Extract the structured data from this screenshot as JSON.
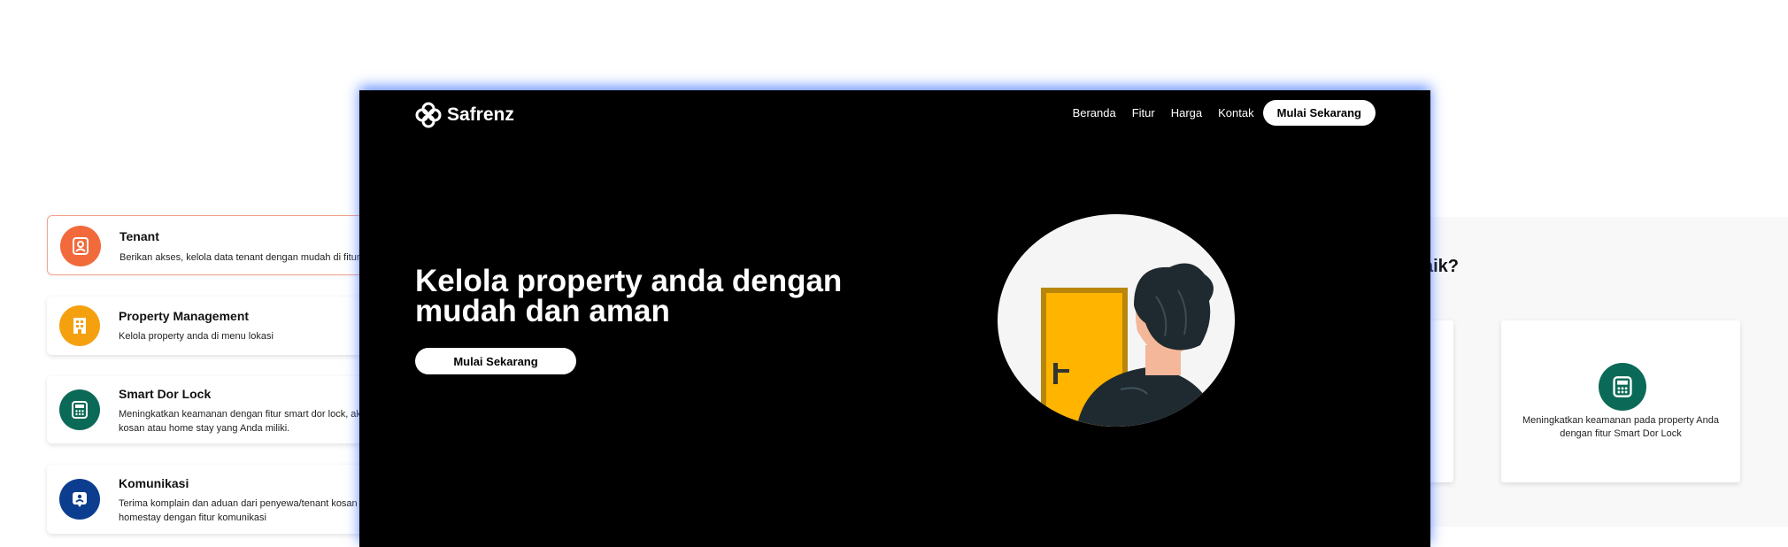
{
  "features": [
    {
      "title": "Tenant",
      "desc": "Berikan akses, kelola data tenant dengan mudah di fitur tenant",
      "icon": "tenant-user-icon",
      "color": "#f26a3b"
    },
    {
      "title": "Property Management",
      "desc": "Kelola property anda di menu lokasi",
      "icon": "building-icon",
      "color": "#f5a10f"
    },
    {
      "title": "Smart Dor Lock",
      "desc": "Meningkatkan keamanan dengan fitur smart dor lock, akses pintu di kosan atau home stay yang Anda miliki.",
      "icon": "keypad-lock-icon",
      "color": "#0b6a57"
    },
    {
      "title": "Komunikasi",
      "desc": "Terima komplain dan aduan dari penyewa/tenant kosan atau homestay dengan fitur komunikasi",
      "icon": "chat-user-icon",
      "color": "#0c3d8f"
    }
  ],
  "right_section": {
    "heading": "aik?",
    "card_text": "Meningkatkan keamanan pada property Anda dengan fitur Smart Dor Lock",
    "card_icon": "keypad-lock-icon"
  },
  "hero": {
    "brand": "Safrenz",
    "nav": [
      "Beranda",
      "Fitur",
      "Harga",
      "Kontak"
    ],
    "nav_cta": "Mulai Sekarang",
    "title": "Kelola property anda dengan mudah dan aman",
    "cta": "Mulai Sekarang",
    "illustration": "person-at-door-illustration"
  },
  "colors": {
    "hero_bg": "#000000",
    "door": "#ffb400",
    "door_frame": "#b8860b",
    "hair": "#1f2a30",
    "skin": "#f5b79a"
  }
}
